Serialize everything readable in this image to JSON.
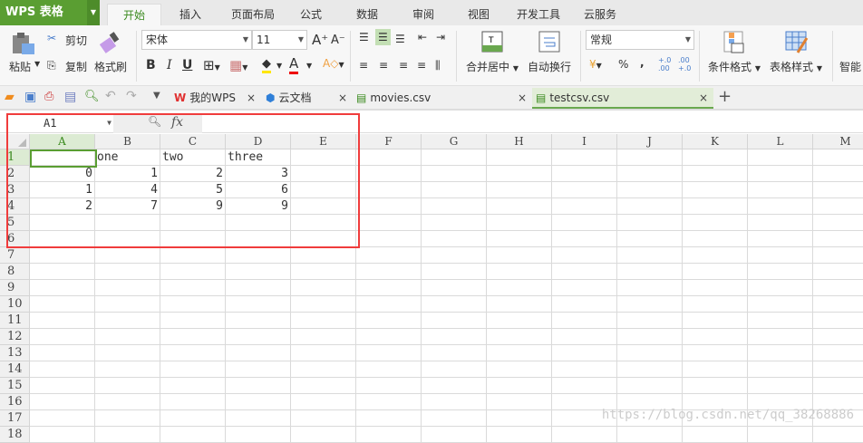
{
  "app": {
    "logo": "WPS 表格"
  },
  "menu_tabs": [
    "开始",
    "插入",
    "页面布局",
    "公式",
    "数据",
    "审阅",
    "视图",
    "开发工具",
    "云服务"
  ],
  "active_tab": 0,
  "ribbon": {
    "paste": "粘贴",
    "cut": "剪切",
    "copy": "复制",
    "format_painter": "格式刷",
    "font_name": "宋体",
    "font_size": "11",
    "bold": "B",
    "italic": "I",
    "underline": "U",
    "merge_center": "合并居中",
    "wrap_text": "自动换行",
    "number_format": "常规",
    "percent": "%",
    "comma": ",",
    "cond_format": "条件格式",
    "table_style": "表格样式",
    "smart": "智能"
  },
  "doc_tabs": [
    {
      "label": "我的WPS"
    },
    {
      "label": "云文档"
    },
    {
      "label": "movies.csv"
    },
    {
      "label": "testcsv.csv",
      "active": true
    }
  ],
  "formula_bar": {
    "name_box": "A1",
    "fx": "fx",
    "value": ""
  },
  "columns": [
    "A",
    "B",
    "C",
    "D",
    "E",
    "F",
    "G",
    "H",
    "I",
    "J",
    "K",
    "L",
    "M"
  ],
  "rows": 18,
  "cells": [
    [
      "",
      "one",
      "two",
      "three"
    ],
    [
      "0",
      "1",
      "2",
      "3"
    ],
    [
      "1",
      "4",
      "5",
      "6"
    ],
    [
      "2",
      "7",
      "9",
      "9"
    ]
  ],
  "active_cell": "A1",
  "watermark": "https://blog.csdn.net/qq_38268886",
  "colors": {
    "accent": "#5a9e32",
    "highlight_box": "#f03c3c"
  }
}
